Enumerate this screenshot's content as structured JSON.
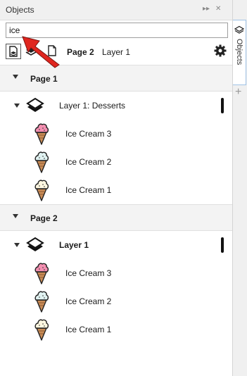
{
  "panel": {
    "title": "Objects"
  },
  "search": {
    "value": "ice"
  },
  "toolbar": {
    "current_page": "Page 2",
    "current_layer": "Layer 1"
  },
  "tree": {
    "sections": [
      {
        "label": "Page 1",
        "layer": {
          "label": "Layer 1: Desserts",
          "bold": false
        },
        "items": [
          "Ice Cream 3",
          "Ice Cream 2",
          "Ice Cream 1"
        ]
      },
      {
        "label": "Page 2",
        "layer": {
          "label": "Layer 1",
          "bold": true
        },
        "items": [
          "Ice Cream 3",
          "Ice Cream 2",
          "Ice Cream 1"
        ]
      }
    ]
  },
  "side": {
    "tab_label": "Objects"
  },
  "icons": {
    "scoop_colors": [
      "#f48fb1",
      "#e0f2f1",
      "#fff8e1"
    ],
    "cone_color": "#c98c57",
    "arrow_color": "#e0261f"
  }
}
